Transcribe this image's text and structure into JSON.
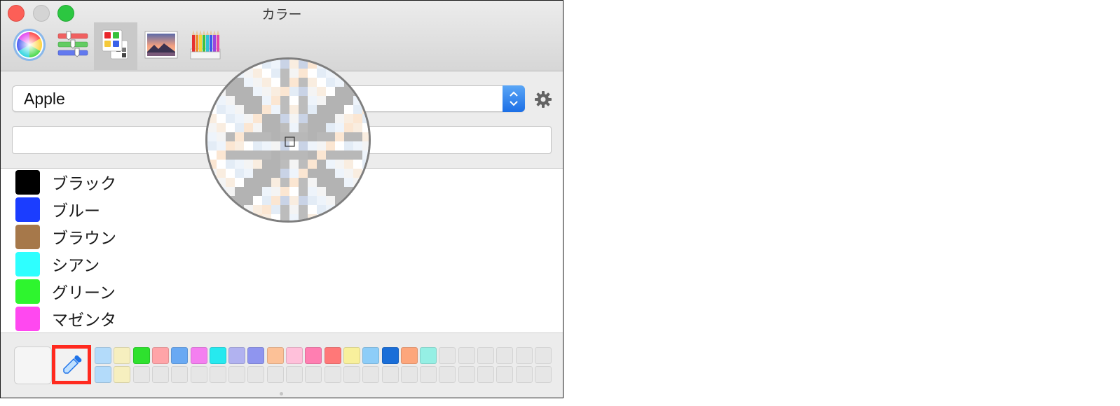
{
  "window": {
    "title": "カラー"
  },
  "toolbar": {
    "tools": [
      {
        "name": "color-wheel",
        "icon": "color-wheel-icon"
      },
      {
        "name": "sliders",
        "icon": "color-sliders-icon"
      },
      {
        "name": "palettes",
        "icon": "color-palettes-icon",
        "selected": true
      },
      {
        "name": "image-palettes",
        "icon": "image-palettes-icon"
      },
      {
        "name": "pencils",
        "icon": "pencils-icon"
      }
    ]
  },
  "palette_popup": {
    "value": "Apple"
  },
  "search": {
    "value": ""
  },
  "color_list": [
    {
      "label": "ブラック",
      "color": "#000000"
    },
    {
      "label": "ブルー",
      "color": "#1b3dff"
    },
    {
      "label": "ブラウン",
      "color": "#a6784a"
    },
    {
      "label": "シアン",
      "color": "#2effff"
    },
    {
      "label": "グリーン",
      "color": "#2ef52e"
    },
    {
      "label": "マゼンタ",
      "color": "#ff48f0"
    }
  ],
  "swatches": {
    "row1": [
      "#b3dbfa",
      "#f6efbf",
      "#2ee12e",
      "#ffa4a8",
      "#69a9f3",
      "#f47ff0",
      "#26e9ef",
      "#b1b2f0",
      "#8f95ef",
      "#fcc197",
      "#ffc0da",
      "#ff7eb1",
      "#ff7878",
      "#f8f09c",
      "#8dcdf8",
      "#1a6ed8",
      "#fda67c",
      "#95efe4",
      "",
      "",
      "",
      "",
      "",
      ""
    ],
    "row2": [
      "#b3dbfa",
      "#f6efbf",
      "",
      "",
      "",
      "",
      "",
      "",
      "",
      "",
      "",
      "",
      "",
      "",
      "",
      "",
      "",
      "",
      "",
      "",
      "",
      "",
      "",
      ""
    ]
  },
  "colors": {
    "accent": "#1f73e8",
    "highlight": "#ff2a1f"
  }
}
